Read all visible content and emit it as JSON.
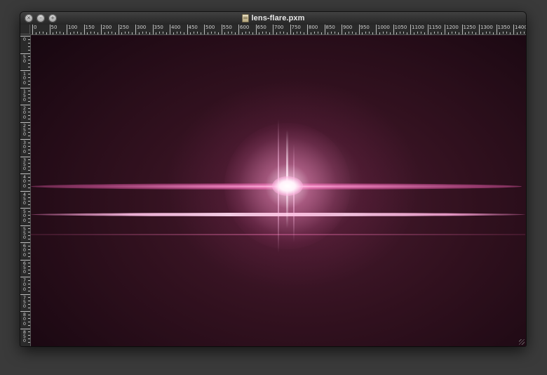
{
  "window": {
    "title": "lens-flare.pxm",
    "buttons": [
      "close",
      "minimize",
      "zoom"
    ],
    "file_icon": "document-icon"
  },
  "rulers": {
    "horizontal_labels": [
      "0",
      "50",
      "100",
      "150",
      "200",
      "250",
      "300",
      "350",
      "400",
      "450",
      "500",
      "550",
      "600",
      "650",
      "700",
      "750",
      "800",
      "850",
      "900",
      "950",
      "1000",
      "1050",
      "1100",
      "1150",
      "1200",
      "1250",
      "1300",
      "1350",
      "1400"
    ],
    "vertical_labels": [
      "0",
      "50",
      "100",
      "150",
      "200",
      "250",
      "300",
      "350",
      "400",
      "450",
      "500",
      "550",
      "600",
      "650",
      "700",
      "750",
      "800",
      "850"
    ]
  },
  "canvas": {
    "image": "lens-flare",
    "colors": {
      "background_dark": "#170710",
      "background_mid": "#4a1b30",
      "flare_pink": "#ff6fc0",
      "flare_core": "#ffffff"
    }
  }
}
